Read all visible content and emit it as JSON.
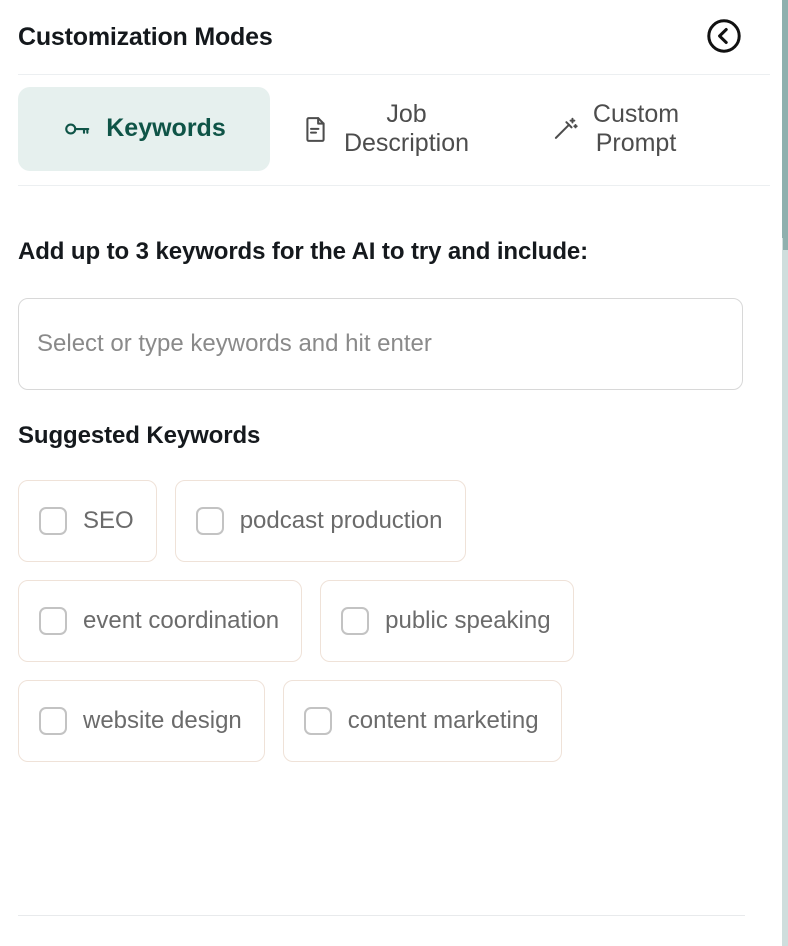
{
  "header": {
    "title": "Customization Modes",
    "back_button_icon": "chevron-left-circle-icon",
    "back_button_label": "Back"
  },
  "tabs": [
    {
      "id": "keywords",
      "label": "Keywords",
      "icon": "key-icon",
      "active": true,
      "active_bg": "#e6f0ee",
      "active_color": "#0f5447"
    },
    {
      "id": "job-description",
      "label": "Job\nDescription",
      "icon": "document-icon",
      "active": false,
      "color": "#4d4d4d"
    },
    {
      "id": "custom-prompt",
      "label": "Custom\nPrompt",
      "icon": "magic-wand-icon",
      "active": false,
      "color": "#4d4d4d"
    }
  ],
  "keywords_panel": {
    "add_heading": "Add up to 3 keywords for the AI to try and include:",
    "input": {
      "value": "",
      "placeholder": "Select or type keywords and hit enter"
    },
    "suggested_heading": "Suggested Keywords",
    "suggested": [
      {
        "label": "SEO",
        "checked": false
      },
      {
        "label": "podcast production",
        "checked": false
      },
      {
        "label": "event coordination",
        "checked": false
      },
      {
        "label": "public speaking",
        "checked": false
      },
      {
        "label": "website design",
        "checked": false
      },
      {
        "label": "content marketing",
        "checked": false
      }
    ]
  },
  "colors": {
    "accent_teal": "#0f5447",
    "tab_active_bg": "#e6f0ee",
    "chip_border": "#efe2d8",
    "divider": "#eceff1",
    "scrollbar_track": "#cfdedd",
    "scrollbar_thumb": "#8fb0ae"
  }
}
